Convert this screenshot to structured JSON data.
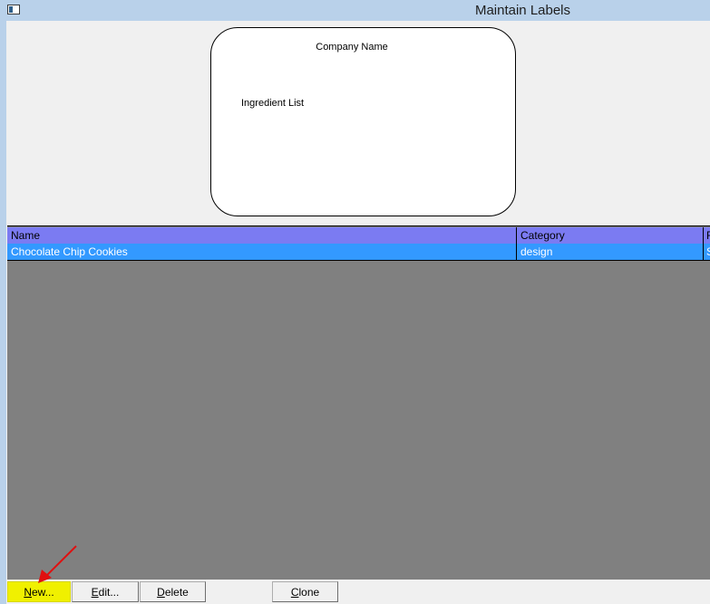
{
  "window": {
    "title": "Maintain Labels",
    "icon": "window-system-icon"
  },
  "preview": {
    "company_name": "Company Name",
    "ingredient_list": "Ingredient List"
  },
  "grid": {
    "columns": [
      "Name",
      "Category",
      "F"
    ],
    "rows": [
      {
        "name": "Chocolate Chip Cookies",
        "category": "design",
        "extra": "S",
        "selected": true
      }
    ]
  },
  "buttons": {
    "new_rest": "ew...",
    "new_key": "N",
    "edit_rest": "dit...",
    "edit_key": "E",
    "delete_rest": "elete",
    "delete_key": "D",
    "clone_rest": "lone",
    "clone_key": "C"
  },
  "annotation": {
    "arrow_color": "#e01010",
    "icon": "pointer-arrow-icon"
  },
  "colors": {
    "titlebar": "#b9d1ea",
    "grid_header": "#7b7bf2",
    "selected_row": "#3399ff",
    "grid_bg": "#808080",
    "highlight_button": "#f0f000"
  }
}
